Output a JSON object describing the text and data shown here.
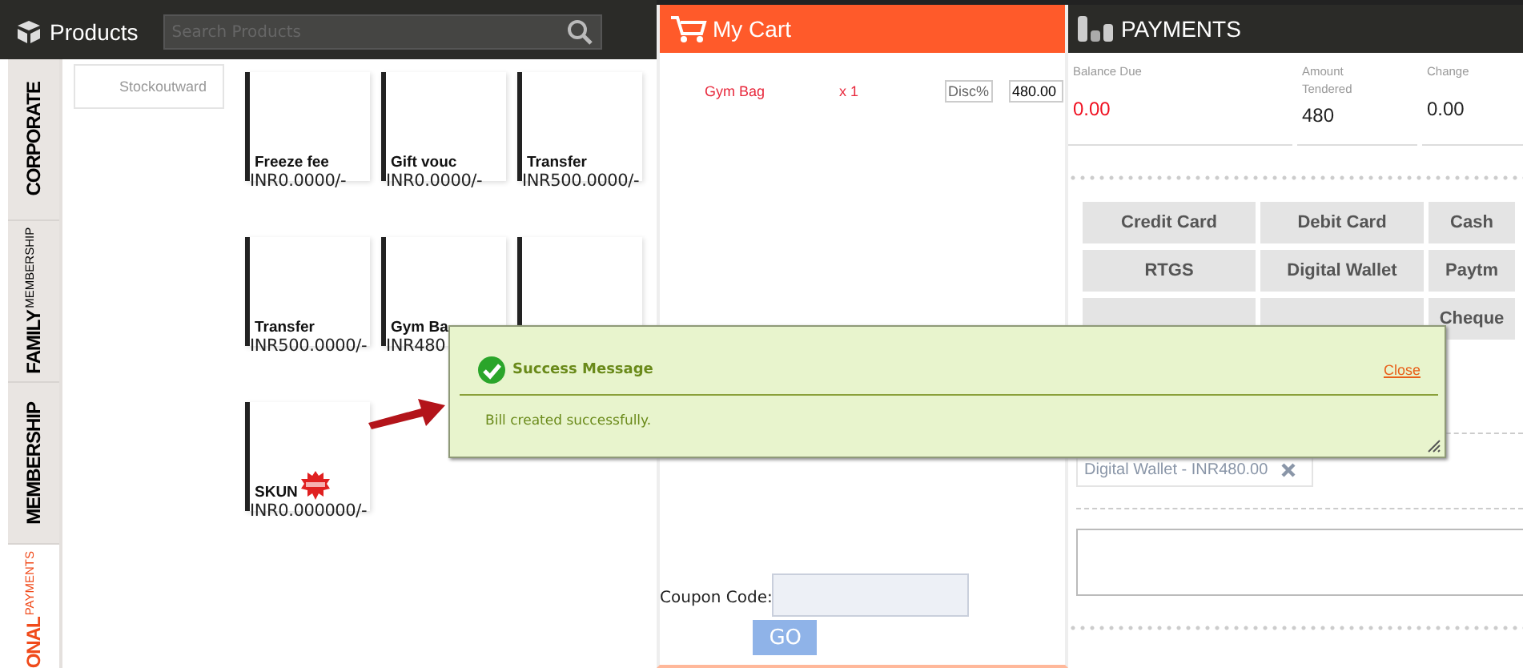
{
  "products": {
    "title": "Products",
    "search": {
      "placeholder": "Search Products"
    },
    "side_tabs": [
      {
        "label": "CORPORATE",
        "selected": false
      },
      {
        "label": "FAMILY",
        "sublabel": "MEMBERSHIP",
        "selected": false
      },
      {
        "label": "MEMBERSHIP",
        "selected": false
      },
      {
        "label": "ONAL",
        "sublabel": "PAYMENTS",
        "selected": true
      }
    ],
    "categories": [
      "Stockoutward"
    ],
    "tiles": [
      {
        "name": "Freeze fee",
        "price": "INR0.0000/-",
        "badge": false
      },
      {
        "name": "Gift vouc",
        "price": "INR0.0000/-",
        "badge": false
      },
      {
        "name": "Transfer",
        "price": "INR500.0000/-",
        "badge": false
      },
      {
        "name": "Transfer",
        "price": "INR500.0000/-",
        "badge": false
      },
      {
        "name": "Gym Ba",
        "price": "INR480",
        "badge": false
      },
      {
        "badge": false
      },
      {
        "name": "SKUN",
        "price": "INR0.000000/-",
        "badge": true
      }
    ]
  },
  "cart": {
    "title": "My Cart",
    "items": [
      {
        "name": "Gym Bag",
        "qty": "x 1",
        "discount_placeholder": "Disc%",
        "amount": "480.00"
      }
    ],
    "coupon": {
      "label": "Coupon Code:",
      "button": "GO"
    }
  },
  "payments": {
    "title": "PAYMENTS",
    "summary": [
      {
        "label": "Balance Due",
        "value": "0.00",
        "kind": "due"
      },
      {
        "label": "Amount Tendered",
        "value": "480",
        "kind": "plain"
      },
      {
        "label": "Change",
        "value": "0.00",
        "kind": "plain"
      }
    ],
    "methods": [
      {
        "kind": "labeled",
        "label": "Credit Card"
      },
      {
        "kind": "labeled",
        "label": "Debit Card"
      },
      {
        "kind": "labeled",
        "label": "Cash"
      },
      {
        "kind": "labeled",
        "label": "RTGS"
      },
      {
        "kind": "labeled",
        "label": "Digital Wallet"
      },
      {
        "kind": "labeled",
        "label": "Paytm"
      },
      {
        "kind": "covered"
      },
      {
        "kind": "covered"
      },
      {
        "kind": "labeled",
        "label": "Cheque"
      }
    ],
    "applied": [
      {
        "label": "Digital Wallet - INR480.00"
      }
    ]
  },
  "dialog": {
    "title": "Success Message",
    "message": "Bill created successfully.",
    "close": "Close"
  }
}
